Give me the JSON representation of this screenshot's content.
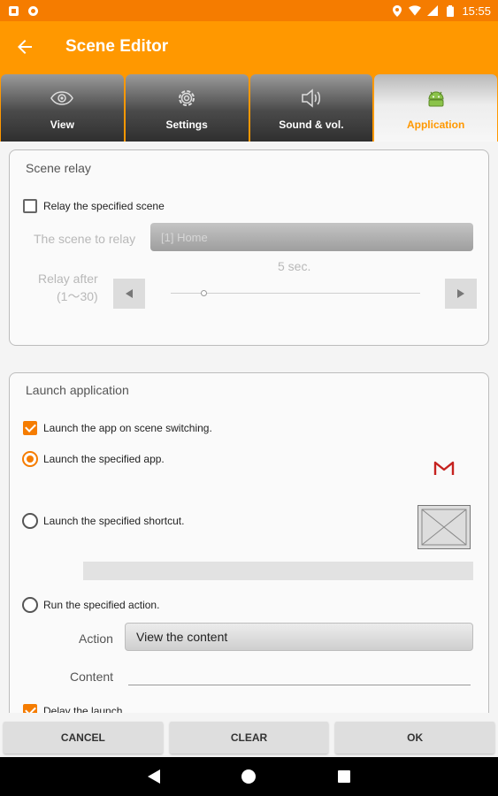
{
  "status_bar": {
    "time": "15:55"
  },
  "app_bar": {
    "title": "Scene Editor"
  },
  "tabs": [
    {
      "label": "View",
      "icon": "eye-icon",
      "active": false
    },
    {
      "label": "Settings",
      "icon": "gear-icon",
      "active": false
    },
    {
      "label": "Sound & vol.",
      "icon": "speaker-icon",
      "active": false
    },
    {
      "label": "Application",
      "icon": "android-icon",
      "active": true
    }
  ],
  "scene_relay": {
    "title": "Scene relay",
    "relay_checkbox_label": "Relay the specified scene",
    "relay_checked": false,
    "scene_label": "The scene to relay",
    "scene_value": "[1] Home",
    "delay_value": "5 sec.",
    "relay_after_label": "Relay after",
    "relay_after_range": "(1〜30)"
  },
  "launch_application": {
    "title": "Launch application",
    "launch_on_switch_label": "Launch the app on scene switching.",
    "launch_on_switch_checked": true,
    "launch_app_label": "Launch the specified app.",
    "launch_shortcut_label": "Launch the specified shortcut.",
    "run_action_label": "Run the specified action.",
    "selected_option": "launch_app",
    "action_label": "Action",
    "action_value": "View the content",
    "content_label": "Content",
    "content_value": "",
    "delay_launch_label": "Delay the launch",
    "delay_launch_checked": true,
    "app_icon": "gmail-icon",
    "app_icon_color": "#c5221f"
  },
  "buttons": {
    "cancel": "CANCEL",
    "clear": "CLEAR",
    "ok": "OK"
  },
  "colors": {
    "accent": "#ff9800",
    "statusbar": "#f57c00"
  }
}
